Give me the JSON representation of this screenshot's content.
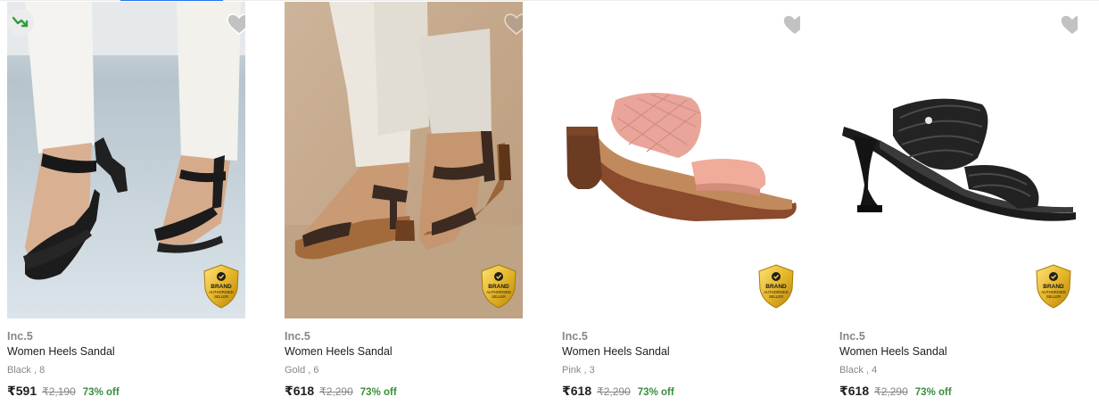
{
  "products": [
    {
      "brand": "Inc.5",
      "title": "Women Heels Sandal",
      "variant": "Black , 8",
      "price": "₹591",
      "mrp": "₹2,190",
      "discount": "73% off",
      "badge": {
        "line1": "BRAND",
        "line2": "AUTHORISED",
        "line3": "SELLER"
      },
      "has_trend_icon": true
    },
    {
      "brand": "Inc.5",
      "title": "Women Heels Sandal",
      "variant": "Gold , 6",
      "price": "₹618",
      "mrp": "₹2,290",
      "discount": "73% off",
      "badge": {
        "line1": "BRAND",
        "line2": "AUTHORISED",
        "line3": "SELLER"
      }
    },
    {
      "brand": "Inc.5",
      "title": "Women Heels Sandal",
      "variant": "Pink , 3",
      "price": "₹618",
      "mrp": "₹2,290",
      "discount": "73% off",
      "badge": {
        "line1": "BRAND",
        "line2": "AUTHORISED",
        "line3": "SELLER"
      }
    },
    {
      "brand": "Inc.5",
      "title": "Women Heels Sandal",
      "variant": "Black , 4",
      "price": "₹618",
      "mrp": "₹2,290",
      "discount": "73% off",
      "badge": {
        "line1": "BRAND",
        "line2": "AUTHORISED",
        "line3": "SELLER"
      }
    }
  ],
  "icons": {
    "wishlist": "heart-icon",
    "trend": "trending-down-icon",
    "badge": "shield-badge-icon"
  },
  "colors": {
    "discount": "#388e3c",
    "muted": "#878787",
    "text": "#212121",
    "accent": "#2874f0",
    "wishlist_heart": "#c2c2c2",
    "badge_gold": "#e5b62a"
  }
}
